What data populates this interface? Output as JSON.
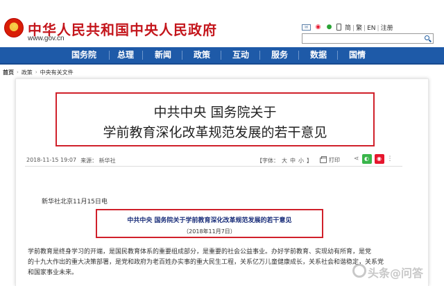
{
  "header": {
    "site_title": "中华人民共和国中央人民政府",
    "site_url": "www.gov.cn",
    "lang_links": [
      "简",
      "繁",
      "EN",
      "注册"
    ],
    "search": {
      "value": "",
      "placeholder": ""
    }
  },
  "nav": {
    "items": [
      "国务院",
      "总理",
      "新闻",
      "政策",
      "互动",
      "服务",
      "数据",
      "国情"
    ]
  },
  "breadcrumb": [
    "首页",
    "政策",
    "中央有关文件"
  ],
  "article": {
    "title_line1": "中共中央 国务院关于",
    "title_line2": "学前教育深化改革规范发展的若干意见",
    "date": "2018-11-15 19:07",
    "source": "来源：  新华社",
    "font_label": "【字体：",
    "font_large": "大",
    "font_medium": "中",
    "font_small": "小",
    "font_close": "】",
    "print_label": "打印",
    "dateline": "新华社北京11月15日电",
    "doc_title": "中共中央  国务院关于学前教育深化改革规范发展的若干意见",
    "doc_date": "（2018年11月7日）",
    "paragraph_lines": [
      "学前教育是终身学习的开端，是国民教育体系的重要组成部分，是重要的社会公益事业。办好学前教育、实现幼有所育，是党",
      "的十九大作出的重大决策部署，是党和政府为老百姓办实事的重大民生工程，关系亿万儿童健康成长，关系社会和谐稳定，关系党",
      "和国家事业未来。"
    ]
  },
  "watermark": "头条@问答",
  "colors": {
    "brand_red": "#c4161c",
    "nav_blue": "#1e5aa8",
    "highlight_red": "#d0202a",
    "doc_title_blue": "#1a2e7a"
  }
}
